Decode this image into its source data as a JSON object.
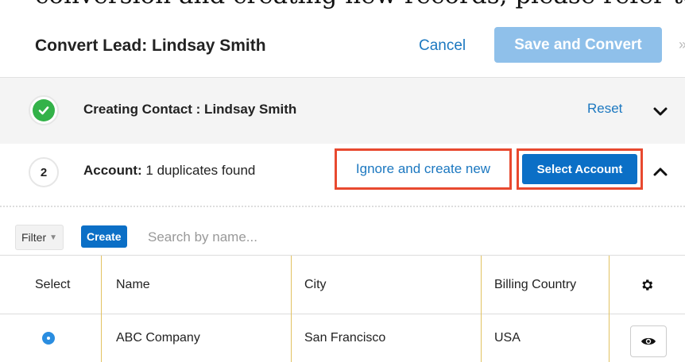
{
  "doc_snippet": {
    "text": "conversion and creating new records, please refer to"
  },
  "header": {
    "title": "Convert Lead: Lindsay Smith",
    "cancel_label": "Cancel",
    "save_label": "Save and Convert"
  },
  "contact_row": {
    "label": "Creating Contact : Lindsay Smith",
    "reset_label": "Reset"
  },
  "account_row": {
    "step_number": "2",
    "label_strong": "Account:",
    "label_text": " 1 duplicates found",
    "ignore_label": "Ignore and create new",
    "select_label": "Select Account"
  },
  "filter_bar": {
    "filter_label": "Filter",
    "create_label": "Create",
    "search_placeholder": "Search by name..."
  },
  "table": {
    "columns": [
      "Select",
      "Name",
      "City",
      "Billing Country"
    ],
    "rows": [
      {
        "name": "ABC Company",
        "city": "San Francisco",
        "country": "USA"
      }
    ]
  },
  "colors": {
    "accent_blue": "#0b6fc6",
    "link_blue": "#1c78c0",
    "disabled_blue": "#8fc0ea",
    "highlight_red": "#e8492f",
    "success_green": "#33b249"
  },
  "icons": [
    "check-icon",
    "chevron-down-icon",
    "chevron-up-icon",
    "caret-down-icon",
    "gear-icon",
    "eye-icon",
    "radio-selected-icon"
  ]
}
